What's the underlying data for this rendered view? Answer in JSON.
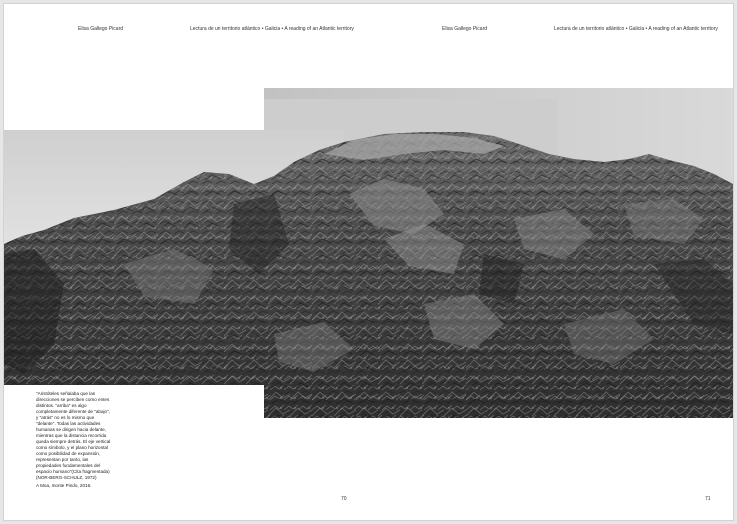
{
  "left_page": {
    "author": "Elisa Gallego Picard",
    "title": "Lectura de un territorio atlántico • Galicia • A reading of an Atlantic territory",
    "page_number": "70"
  },
  "right_page": {
    "author": "Elisa Gallego Picard",
    "title": "Lectura de un territorio atlántico • Galicia • A reading of an Atlantic territory",
    "page_number": "71"
  },
  "caption": {
    "quote": "\"Aristóteles señalaba que las direcciones se perciben como entes distintos. \"arriba\" es algo completamente diferente de \"abajo\", y \"atrás\" no es lo mismo que \"delante\". Todas las actividades humanas se dirigen hacia delante, mientras que la distancia recorrida queda siempre detrás. El eje vertical como símbolo, y el plano horizontal como posibilidad de expansión, representan por tanto, las propiedades fundamentales del espacio humano\"(Cita fragmentada) (NOR-BERG-SCHULZ, 1972)",
    "place": "A Moa, monte Pindo, 2016."
  }
}
